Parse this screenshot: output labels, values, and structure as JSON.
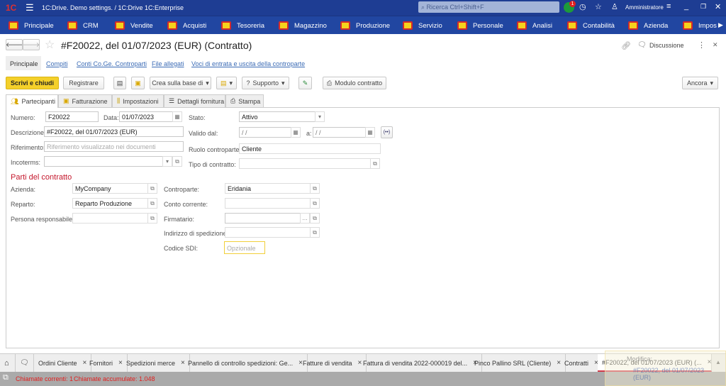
{
  "titlebar": {
    "app_title": "1C:Drive. Demo settings. / 1C:Drive 1C:Enterprise",
    "search_placeholder": "Ricerca Ctrl+Shift+F",
    "notification_count": "1",
    "user": "Amministratore",
    "logo": "1C"
  },
  "nav": {
    "items": [
      "Principale",
      "CRM",
      "Vendite",
      "Acquisti",
      "Tesoreria",
      "Magazzino",
      "Produzione",
      "Servizio",
      "Personale",
      "Analisi",
      "Contabilità",
      "Azienda",
      "Impos"
    ]
  },
  "form": {
    "title": "#F20022, del 01/07/2023 (EUR) (Contratto)",
    "discussion": "Discussione",
    "links": [
      "Principale",
      "Compiti",
      "Conti Co.Ge. Controparti",
      "File allegati",
      "Voci di entrata e uscita della controparte"
    ],
    "toolbar": {
      "write_close": "Scrivi e chiudi",
      "register": "Registrare",
      "create_based": "Crea sulla base di",
      "support": "Supporto",
      "contract_form": "Modulo contratto",
      "more": "Ancora"
    },
    "tabs": [
      "Partecipanti",
      "Fatturazione",
      "Impostazioni",
      "Dettagli fornitura",
      "Stampa"
    ],
    "fields": {
      "numero_label": "Numero:",
      "numero": "F20022",
      "data_label": "Data:",
      "data": "01/07/2023",
      "stato_label": "Stato:",
      "stato": "Attivo",
      "descrizione_label": "Descrizione:",
      "descrizione": "#F20022, del 01/07/2023 (EUR)",
      "valido_label": "Valido dal:",
      "valido_dal": " /  /",
      "a_label": "a:",
      "valido_a": " /  /",
      "riferimento_label": "Riferimento:",
      "riferimento_placeholder": "Riferimento visualizzato nei documenti",
      "ruolo_label": "Ruolo controparte:",
      "ruolo": "Cliente",
      "incoterms_label": "Incoterms:",
      "tipo_label": "Tipo di contratto:",
      "section_title": "Parti del contratto",
      "azienda_label": "Azienda:",
      "azienda": "MyCompany",
      "controparte_label": "Controparte:",
      "controparte": "Eridania",
      "reparto_label": "Reparto:",
      "reparto": "Reparto Produzione",
      "conto_label": "Conto corrente:",
      "persona_label": "Persona responsabile:",
      "firmatario_label": "Firmatario:",
      "indirizzo_label": "Indirizzo di spedizione:",
      "sdi_label": "Codice SDI:",
      "sdi_placeholder": "Opzionale"
    }
  },
  "open_tabs": [
    "Ordini Cliente",
    "Fornitori",
    "Spedizioni merce",
    "Pannello di controllo spedizioni: Ge...",
    "Fatture di vendita",
    "Fattura di vendita 2022-000019 del...",
    "Pinco Pallino SRL (Cliente)",
    "Contratti",
    "#F20022, del 01/07/2023 (EUR) (..."
  ],
  "notification": {
    "title": "Modifica:",
    "text": "#F20022, del 01/07/2023 (EUR)"
  },
  "status": {
    "current_calls": "Chiamate correnti: 1",
    "accumulated_calls": "Chiamate accumulate: 1.048"
  },
  "colors": {
    "titlebar": "#1e3d93",
    "accent_yellow": "#f5d21c",
    "section_red": "#c4172c",
    "link": "#3b6bb5"
  }
}
